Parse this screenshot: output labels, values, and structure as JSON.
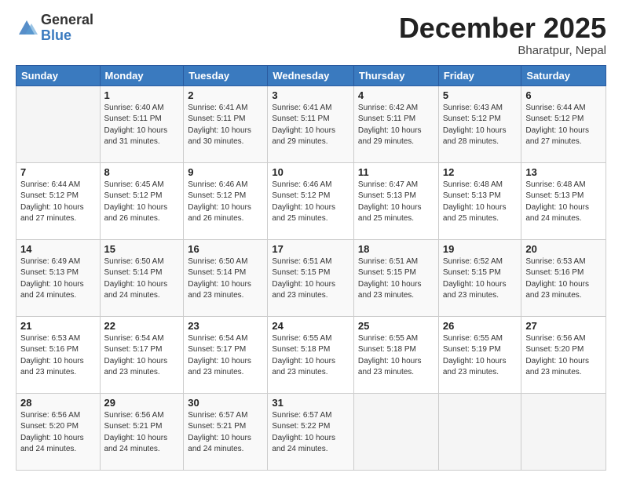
{
  "header": {
    "logo_general": "General",
    "logo_blue": "Blue",
    "month_title": "December 2025",
    "location": "Bharatpur, Nepal"
  },
  "weekdays": [
    "Sunday",
    "Monday",
    "Tuesday",
    "Wednesday",
    "Thursday",
    "Friday",
    "Saturday"
  ],
  "weeks": [
    [
      {
        "day": "",
        "sunrise": "",
        "sunset": "",
        "daylight": ""
      },
      {
        "day": "1",
        "sunrise": "Sunrise: 6:40 AM",
        "sunset": "Sunset: 5:11 PM",
        "daylight": "Daylight: 10 hours and 31 minutes."
      },
      {
        "day": "2",
        "sunrise": "Sunrise: 6:41 AM",
        "sunset": "Sunset: 5:11 PM",
        "daylight": "Daylight: 10 hours and 30 minutes."
      },
      {
        "day": "3",
        "sunrise": "Sunrise: 6:41 AM",
        "sunset": "Sunset: 5:11 PM",
        "daylight": "Daylight: 10 hours and 29 minutes."
      },
      {
        "day": "4",
        "sunrise": "Sunrise: 6:42 AM",
        "sunset": "Sunset: 5:11 PM",
        "daylight": "Daylight: 10 hours and 29 minutes."
      },
      {
        "day": "5",
        "sunrise": "Sunrise: 6:43 AM",
        "sunset": "Sunset: 5:12 PM",
        "daylight": "Daylight: 10 hours and 28 minutes."
      },
      {
        "day": "6",
        "sunrise": "Sunrise: 6:44 AM",
        "sunset": "Sunset: 5:12 PM",
        "daylight": "Daylight: 10 hours and 27 minutes."
      }
    ],
    [
      {
        "day": "7",
        "sunrise": "Sunrise: 6:44 AM",
        "sunset": "Sunset: 5:12 PM",
        "daylight": "Daylight: 10 hours and 27 minutes."
      },
      {
        "day": "8",
        "sunrise": "Sunrise: 6:45 AM",
        "sunset": "Sunset: 5:12 PM",
        "daylight": "Daylight: 10 hours and 26 minutes."
      },
      {
        "day": "9",
        "sunrise": "Sunrise: 6:46 AM",
        "sunset": "Sunset: 5:12 PM",
        "daylight": "Daylight: 10 hours and 26 minutes."
      },
      {
        "day": "10",
        "sunrise": "Sunrise: 6:46 AM",
        "sunset": "Sunset: 5:12 PM",
        "daylight": "Daylight: 10 hours and 25 minutes."
      },
      {
        "day": "11",
        "sunrise": "Sunrise: 6:47 AM",
        "sunset": "Sunset: 5:13 PM",
        "daylight": "Daylight: 10 hours and 25 minutes."
      },
      {
        "day": "12",
        "sunrise": "Sunrise: 6:48 AM",
        "sunset": "Sunset: 5:13 PM",
        "daylight": "Daylight: 10 hours and 25 minutes."
      },
      {
        "day": "13",
        "sunrise": "Sunrise: 6:48 AM",
        "sunset": "Sunset: 5:13 PM",
        "daylight": "Daylight: 10 hours and 24 minutes."
      }
    ],
    [
      {
        "day": "14",
        "sunrise": "Sunrise: 6:49 AM",
        "sunset": "Sunset: 5:13 PM",
        "daylight": "Daylight: 10 hours and 24 minutes."
      },
      {
        "day": "15",
        "sunrise": "Sunrise: 6:50 AM",
        "sunset": "Sunset: 5:14 PM",
        "daylight": "Daylight: 10 hours and 24 minutes."
      },
      {
        "day": "16",
        "sunrise": "Sunrise: 6:50 AM",
        "sunset": "Sunset: 5:14 PM",
        "daylight": "Daylight: 10 hours and 23 minutes."
      },
      {
        "day": "17",
        "sunrise": "Sunrise: 6:51 AM",
        "sunset": "Sunset: 5:15 PM",
        "daylight": "Daylight: 10 hours and 23 minutes."
      },
      {
        "day": "18",
        "sunrise": "Sunrise: 6:51 AM",
        "sunset": "Sunset: 5:15 PM",
        "daylight": "Daylight: 10 hours and 23 minutes."
      },
      {
        "day": "19",
        "sunrise": "Sunrise: 6:52 AM",
        "sunset": "Sunset: 5:15 PM",
        "daylight": "Daylight: 10 hours and 23 minutes."
      },
      {
        "day": "20",
        "sunrise": "Sunrise: 6:53 AM",
        "sunset": "Sunset: 5:16 PM",
        "daylight": "Daylight: 10 hours and 23 minutes."
      }
    ],
    [
      {
        "day": "21",
        "sunrise": "Sunrise: 6:53 AM",
        "sunset": "Sunset: 5:16 PM",
        "daylight": "Daylight: 10 hours and 23 minutes."
      },
      {
        "day": "22",
        "sunrise": "Sunrise: 6:54 AM",
        "sunset": "Sunset: 5:17 PM",
        "daylight": "Daylight: 10 hours and 23 minutes."
      },
      {
        "day": "23",
        "sunrise": "Sunrise: 6:54 AM",
        "sunset": "Sunset: 5:17 PM",
        "daylight": "Daylight: 10 hours and 23 minutes."
      },
      {
        "day": "24",
        "sunrise": "Sunrise: 6:55 AM",
        "sunset": "Sunset: 5:18 PM",
        "daylight": "Daylight: 10 hours and 23 minutes."
      },
      {
        "day": "25",
        "sunrise": "Sunrise: 6:55 AM",
        "sunset": "Sunset: 5:18 PM",
        "daylight": "Daylight: 10 hours and 23 minutes."
      },
      {
        "day": "26",
        "sunrise": "Sunrise: 6:55 AM",
        "sunset": "Sunset: 5:19 PM",
        "daylight": "Daylight: 10 hours and 23 minutes."
      },
      {
        "day": "27",
        "sunrise": "Sunrise: 6:56 AM",
        "sunset": "Sunset: 5:20 PM",
        "daylight": "Daylight: 10 hours and 23 minutes."
      }
    ],
    [
      {
        "day": "28",
        "sunrise": "Sunrise: 6:56 AM",
        "sunset": "Sunset: 5:20 PM",
        "daylight": "Daylight: 10 hours and 24 minutes."
      },
      {
        "day": "29",
        "sunrise": "Sunrise: 6:56 AM",
        "sunset": "Sunset: 5:21 PM",
        "daylight": "Daylight: 10 hours and 24 minutes."
      },
      {
        "day": "30",
        "sunrise": "Sunrise: 6:57 AM",
        "sunset": "Sunset: 5:21 PM",
        "daylight": "Daylight: 10 hours and 24 minutes."
      },
      {
        "day": "31",
        "sunrise": "Sunrise: 6:57 AM",
        "sunset": "Sunset: 5:22 PM",
        "daylight": "Daylight: 10 hours and 24 minutes."
      },
      {
        "day": "",
        "sunrise": "",
        "sunset": "",
        "daylight": ""
      },
      {
        "day": "",
        "sunrise": "",
        "sunset": "",
        "daylight": ""
      },
      {
        "day": "",
        "sunrise": "",
        "sunset": "",
        "daylight": ""
      }
    ]
  ]
}
